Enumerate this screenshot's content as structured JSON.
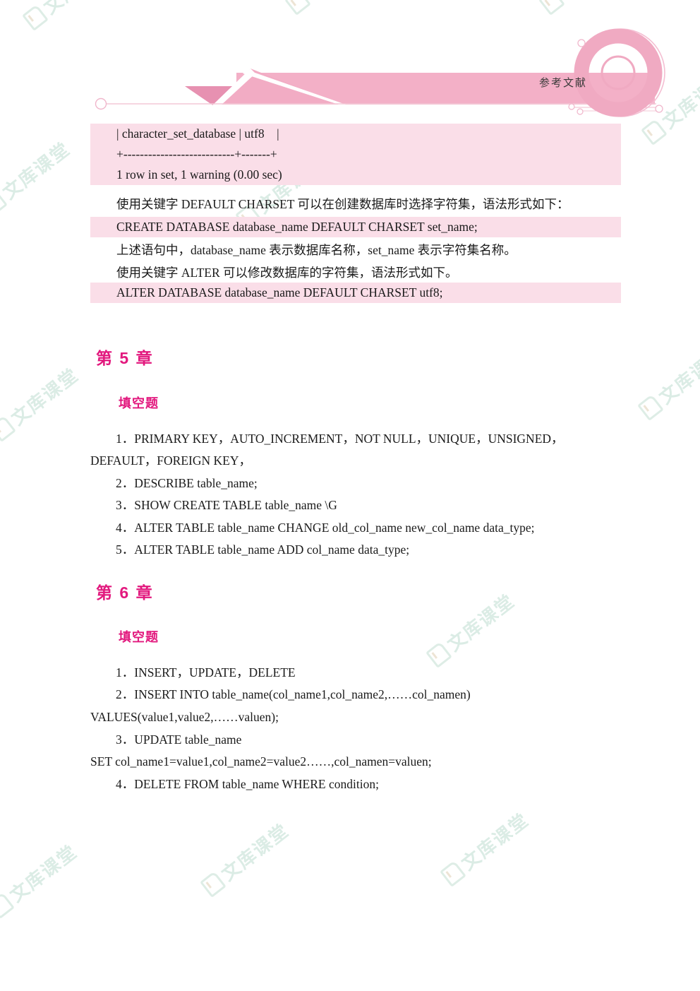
{
  "header": {
    "title": "参考文献",
    "band_color": "#f2acc4",
    "ring_color": "#f0aac2",
    "line_color": "#f3c9d7"
  },
  "watermark": {
    "text": "文库课堂",
    "icon": "book-icon",
    "color": "#cfe6dd"
  },
  "theme": {
    "highlight_bg": "#fadee8",
    "heading_color": "#e2197e",
    "body_color": "#1a1a1a"
  },
  "code_block_top": {
    "lines": [
      "| character_set_database | utf8    |",
      "+---------------------------+-------+",
      "1 row in set, 1 warning (0.00 sec)"
    ]
  },
  "body": {
    "p1": "使用关键字 DEFAULT CHARSET 可以在创建数据库时选择字符集，语法形式如下：",
    "code1": "CREATE DATABASE database_name DEFAULT CHARSET set_name;",
    "p2": "上述语句中，database_name 表示数据库名称，set_name 表示字符集名称。",
    "p3": "使用关键字 ALTER 可以修改数据库的字符集，语法形式如下。",
    "code2": "ALTER DATABASE database_name DEFAULT CHARSET utf8;"
  },
  "chapter5": {
    "heading": "第 5 章",
    "subheading": "填空题",
    "items": [
      "1．PRIMARY KEY，AUTO_INCREMENT，NOT NULL，UNIQUE，UNSIGNED，",
      "DEFAULT，FOREIGN KEY，",
      "2．DESCRIBE table_name;",
      "3．SHOW CREATE TABLE table_name \\G",
      "4．ALTER TABLE table_name CHANGE old_col_name new_col_name data_type;",
      "5．ALTER TABLE table_name ADD col_name data_type;"
    ]
  },
  "chapter6": {
    "heading": "第 6 章",
    "subheading": "填空题",
    "items": [
      "1．INSERT，UPDATE，DELETE",
      "2．INSERT INTO table_name(col_name1,col_name2,……col_namen)",
      "VALUES(value1,value2,……valuen);",
      "3．UPDATE table_name",
      "SET col_name1=value1,col_name2=value2……,col_namen=valuen;",
      "4．DELETE FROM table_name WHERE condition;"
    ]
  }
}
